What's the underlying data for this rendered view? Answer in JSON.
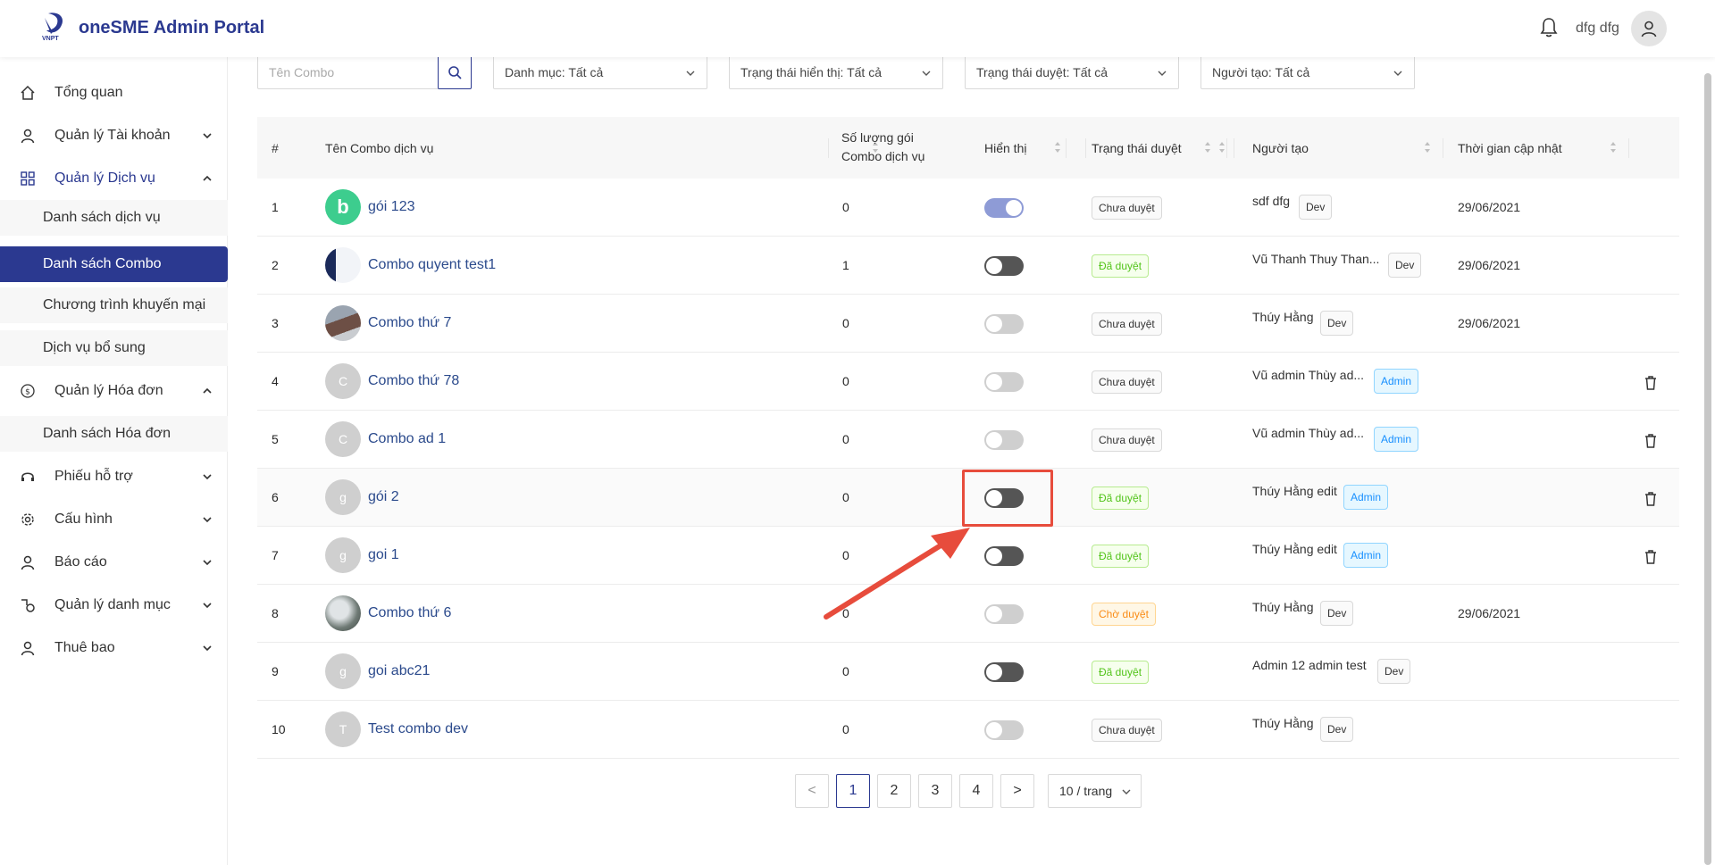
{
  "header": {
    "app_title": "oneSME Admin Portal",
    "logo_text": "VNPT",
    "username": "dfg dfg",
    "icons": {
      "notification": "bell-icon",
      "user": "user-avatar-icon"
    }
  },
  "sidebar": {
    "items": [
      {
        "label": "Tổng quan",
        "icon": "home-icon"
      },
      {
        "label": "Quản lý Tài khoản",
        "icon": "user-icon"
      },
      {
        "label": "Quản lý Dịch vụ",
        "icon": "apps-icon"
      },
      {
        "label": "Danh sách dịch vụ"
      },
      {
        "label": "Danh sách Combo"
      },
      {
        "label": "Chương trình khuyến mại"
      },
      {
        "label": "Dịch vụ bổ sung"
      },
      {
        "label": "Quản lý Hóa đơn",
        "icon": "dollar-icon"
      },
      {
        "label": "Danh sách Hóa đơn"
      },
      {
        "label": "Phiếu hỗ trợ",
        "icon": "headset-icon"
      },
      {
        "label": "Cấu hình",
        "icon": "gear-icon"
      },
      {
        "label": "Báo cáo",
        "icon": "user-icon"
      },
      {
        "label": "Quản lý danh mục",
        "icon": "category-icon"
      },
      {
        "label": "Thuê bao",
        "icon": "user-icon"
      }
    ],
    "active": "Danh sách Combo"
  },
  "filters": {
    "search_placeholder": "Tên Combo",
    "category": "Danh mục: Tất cả",
    "display_status": "Trạng thái hiển thị: Tất cả",
    "approval_status": "Trạng thái duyệt: Tất cả",
    "creator": "Người tạo: Tất cả"
  },
  "table": {
    "columns": {
      "index": "#",
      "name": "Tên Combo dịch vụ",
      "count_line1": "Số lượng gói",
      "count_line2": "Combo dịch vụ",
      "display": "Hiển thị",
      "approval": "Trạng thái duyệt",
      "creator": "Người tạo",
      "updated": "Thời gian cập nhật"
    },
    "rows": [
      {
        "no": "1",
        "avatar": "b",
        "name": "gói 123",
        "count": "0",
        "display": "on",
        "status": "Chưa duyệt",
        "creator": "sdf dfg",
        "role": "Dev",
        "updated": "29/06/2021",
        "deletable": false
      },
      {
        "no": "2",
        "avatar": "",
        "name": "Combo quyent test1",
        "count": "1",
        "display": "off",
        "status": "Đã duyệt",
        "creator": "Vũ Thanh Thuy Than...",
        "role": "Dev",
        "updated": "29/06/2021",
        "deletable": false
      },
      {
        "no": "3",
        "avatar": "",
        "name": "Combo thứ 7",
        "count": "0",
        "display": "disabled",
        "status": "Chưa duyệt",
        "creator": "Thúy Hằng",
        "role": "Dev",
        "updated": "29/06/2021",
        "deletable": false
      },
      {
        "no": "4",
        "avatar": "C",
        "name": "Combo thứ 78",
        "count": "0",
        "display": "disabled",
        "status": "Chưa duyệt",
        "creator": "Vũ admin Thùy ad...",
        "role": "Admin",
        "updated": "",
        "deletable": true
      },
      {
        "no": "5",
        "avatar": "C",
        "name": "Combo ad 1",
        "count": "0",
        "display": "disabled",
        "status": "Chưa duyệt",
        "creator": "Vũ admin Thùy ad...",
        "role": "Admin",
        "updated": "",
        "deletable": true
      },
      {
        "no": "6",
        "avatar": "g",
        "name": "gói 2",
        "count": "0",
        "display": "off",
        "status": "Đã duyệt",
        "creator": "Thúy Hằng edit",
        "role": "Admin",
        "updated": "",
        "deletable": true
      },
      {
        "no": "7",
        "avatar": "g",
        "name": "goi 1",
        "count": "0",
        "display": "off",
        "status": "Đã duyệt",
        "creator": "Thúy Hằng edit",
        "role": "Admin",
        "updated": "",
        "deletable": true
      },
      {
        "no": "8",
        "avatar": "",
        "name": "Combo thứ 6",
        "count": "0",
        "display": "disabled",
        "status": "Chờ duyệt",
        "creator": "Thúy Hằng",
        "role": "Dev",
        "updated": "29/06/2021",
        "deletable": false
      },
      {
        "no": "9",
        "avatar": "g",
        "name": "goi abc21",
        "count": "0",
        "display": "off",
        "status": "Đã duyệt",
        "creator": "Admin 12 admin test",
        "role": "Dev",
        "updated": "",
        "deletable": false
      },
      {
        "no": "10",
        "avatar": "T",
        "name": "Test combo dev",
        "count": "0",
        "display": "disabled",
        "status": "Chưa duyệt",
        "creator": "Thúy Hằng",
        "role": "Dev",
        "updated": "",
        "deletable": false
      }
    ]
  },
  "pagination": {
    "prev": "<",
    "next": ">",
    "pages": [
      "1",
      "2",
      "3",
      "4"
    ],
    "current": "1",
    "page_size": "10 / trang"
  },
  "colors": {
    "brand": "#2b3990",
    "link": "#2b4a8c",
    "highlight": "#e74c3c",
    "toggle_on": "#8e9bd6",
    "toggle_off": "#555555",
    "toggle_disabled": "#cfcfcf"
  }
}
